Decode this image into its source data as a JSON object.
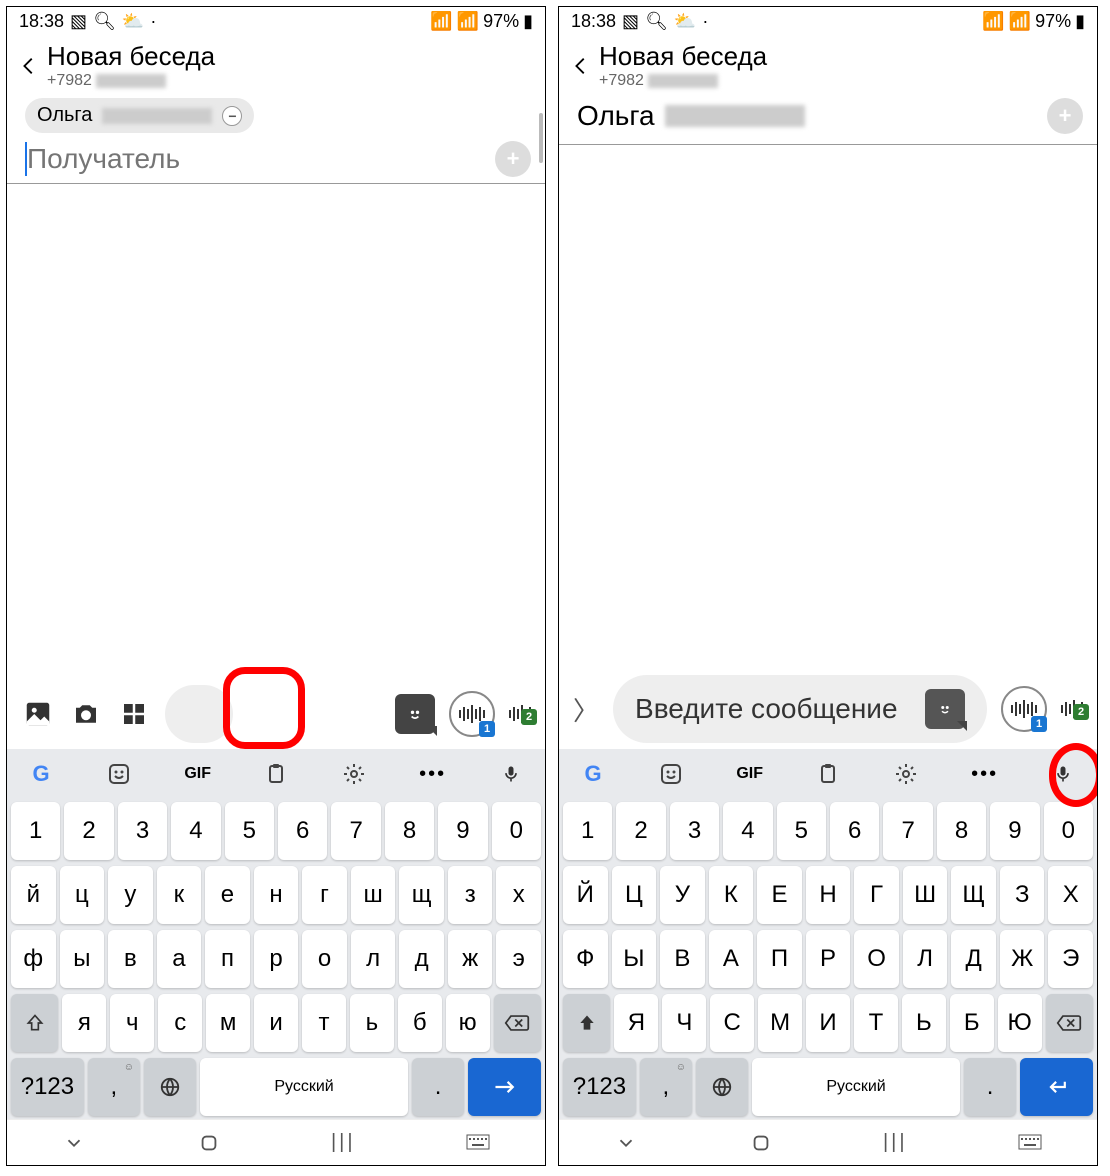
{
  "status": {
    "time": "18:38",
    "battery": "97%"
  },
  "header": {
    "title": "Новая беседа",
    "phone_prefix": "+7982"
  },
  "left": {
    "chip_name_visible": "Ольга",
    "recipient_placeholder": "Получатель"
  },
  "right": {
    "recipient_prefix": "Ольга",
    "message_placeholder": "Введите сообщение"
  },
  "badges": {
    "voice1": "1",
    "voice2": "2"
  },
  "kbd_toolbar": {
    "gif": "GIF"
  },
  "kbd": {
    "nums": [
      "1",
      "2",
      "3",
      "4",
      "5",
      "6",
      "7",
      "8",
      "9",
      "0"
    ],
    "r1_low": [
      "й",
      "ц",
      "у",
      "к",
      "е",
      "н",
      "г",
      "ш",
      "щ",
      "з",
      "х"
    ],
    "r2_low": [
      "ф",
      "ы",
      "в",
      "а",
      "п",
      "р",
      "о",
      "л",
      "д",
      "ж",
      "э"
    ],
    "r3_low": [
      "я",
      "ч",
      "с",
      "м",
      "и",
      "т",
      "ь",
      "б",
      "ю"
    ],
    "r1_up": [
      "Й",
      "Ц",
      "У",
      "К",
      "Е",
      "Н",
      "Г",
      "Ш",
      "Щ",
      "З",
      "Х"
    ],
    "r2_up": [
      "Ф",
      "Ы",
      "В",
      "А",
      "П",
      "Р",
      "О",
      "Л",
      "Д",
      "Ж",
      "Э"
    ],
    "r3_up": [
      "Я",
      "Ч",
      "С",
      "М",
      "И",
      "Т",
      "Ь",
      "Б",
      "Ю"
    ],
    "symkey": "?123",
    "comma": ",",
    "period": ".",
    "space_label": "Русский",
    "comma_corner": "☺",
    "period_corner": ""
  }
}
